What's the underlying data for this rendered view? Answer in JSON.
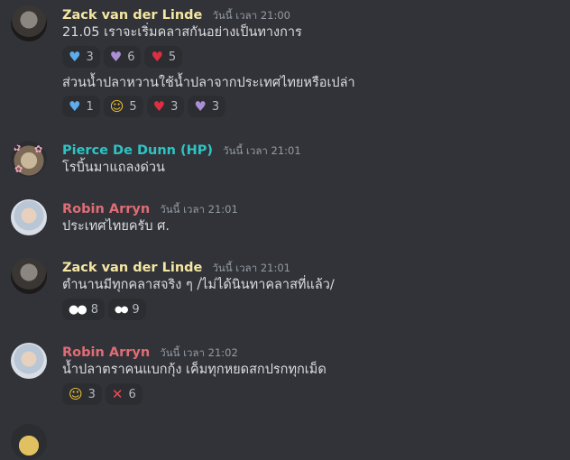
{
  "messages": [
    {
      "author": "Zack van der Linde",
      "time": "วันนี้ เวลา 21:00",
      "lines": [
        {
          "text": "21.05 เราจะเริ่มคลาสกันอย่างเป็นทางการ",
          "reactions": [
            {
              "icon": "blue-heart",
              "count": "3"
            },
            {
              "icon": "purple-heart",
              "count": "6"
            },
            {
              "icon": "red-heart",
              "count": "5"
            }
          ]
        },
        {
          "text": "ส่วนน้ำปลาหวานใช้น้ำปลาจากประเทศไทยหรือเปล่า",
          "reactions": [
            {
              "icon": "blue-heart",
              "count": "1"
            },
            {
              "icon": "joy-emoji",
              "count": "5"
            },
            {
              "icon": "red-heart",
              "count": "3"
            },
            {
              "icon": "purple-heart",
              "count": "3"
            }
          ]
        }
      ]
    },
    {
      "author": "Pierce De Dunn (HP)",
      "time": "วันนี้ เวลา 21:01",
      "lines": [
        {
          "text": "โรบิ้นมาแถลงด่วน"
        }
      ]
    },
    {
      "author": "Robin Arryn",
      "time": "วันนี้ เวลา 21:01",
      "lines": [
        {
          "text": "ประเทศไทยครับ ศ."
        }
      ]
    },
    {
      "author": "Zack van der Linde",
      "time": "วันนี้ เวลา 21:01",
      "lines": [
        {
          "text": "ตำนานมีทุกคลาสจริง ๆ /ไม่ได้นินทาคลาสที่แล้ว/",
          "reactions": [
            {
              "icon": "eyes-emoji",
              "count": "8"
            },
            {
              "icon": "eyes-small-emoji",
              "count": "9"
            }
          ]
        }
      ]
    },
    {
      "author": "Robin Arryn",
      "time": "วันนี้ เวลา 21:02",
      "lines": [
        {
          "text": "น้ำปลาตราคนแบกกุ้ง เค็มทุกหยดสกปรกทุกเม็ด",
          "reactions": [
            {
              "icon": "joy-emoji",
              "count": "3"
            },
            {
              "icon": "red-cross-icon",
              "count": "6"
            }
          ]
        }
      ]
    }
  ],
  "colors": {
    "background": "#313338",
    "zack_name": "#f5e7a3",
    "pierce_name": "#2ec4c4",
    "robin_name": "#e06c75",
    "reaction_bg": "#2b2d31"
  }
}
